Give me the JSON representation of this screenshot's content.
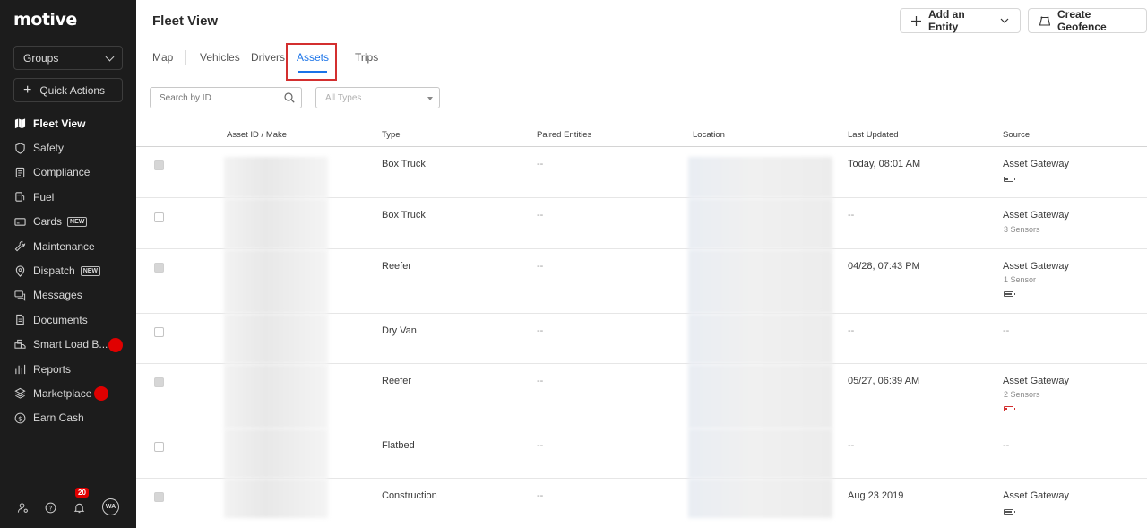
{
  "brand": {
    "logo": "motive"
  },
  "sidebar": {
    "groups_label": "Groups",
    "quick_actions_label": "Quick Actions",
    "items": [
      {
        "label": "Fleet View",
        "icon": "map-icon",
        "active": true
      },
      {
        "label": "Safety",
        "icon": "shield-icon"
      },
      {
        "label": "Compliance",
        "icon": "document-icon"
      },
      {
        "label": "Fuel",
        "icon": "fuel-icon"
      },
      {
        "label": "Cards",
        "icon": "card-icon",
        "tag": "NEW"
      },
      {
        "label": "Maintenance",
        "icon": "wrench-icon"
      },
      {
        "label": "Dispatch",
        "icon": "location-pin-icon",
        "tag": "NEW"
      },
      {
        "label": "Messages",
        "icon": "chat-icon"
      },
      {
        "label": "Documents",
        "icon": "file-icon"
      },
      {
        "label": "Smart Load B...",
        "icon": "truck-load-icon",
        "dot": true
      },
      {
        "label": "Reports",
        "icon": "bar-chart-icon"
      },
      {
        "label": "Marketplace",
        "icon": "layers-icon",
        "dot": true
      },
      {
        "label": "Earn Cash",
        "icon": "dollar-icon"
      }
    ],
    "bottom": {
      "notifications_count": "20",
      "avatar_initials": "WA"
    }
  },
  "header": {
    "title": "Fleet View",
    "add_entity_label": "Add an Entity",
    "create_geofence_label": "Create Geofence"
  },
  "tabs": [
    "Map",
    "Vehicles",
    "Drivers",
    "Assets",
    "Trips"
  ],
  "active_tab": "Assets",
  "filters": {
    "search_placeholder": "Search by ID",
    "type_placeholder": "All Types"
  },
  "table": {
    "columns": [
      "Asset ID / Make",
      "Type",
      "Paired Entities",
      "Location",
      "Last Updated",
      "Source"
    ],
    "rows": [
      {
        "type": "Box Truck",
        "paired": "--",
        "updated": "Today, 08:01 AM",
        "source": "Asset Gateway",
        "source_sub": "",
        "battery": "low-gray",
        "checkbox_disabled": true
      },
      {
        "type": "Box Truck",
        "paired": "--",
        "updated": "--",
        "source": "Asset Gateway",
        "source_sub": "3 Sensors",
        "battery": "",
        "checkbox_disabled": false
      },
      {
        "type": "Reefer",
        "paired": "--",
        "updated": "04/28, 07:43 PM",
        "source": "Asset Gateway",
        "source_sub": "1 Sensor",
        "battery": "full",
        "checkbox_disabled": true
      },
      {
        "type": "Dry Van",
        "paired": "--",
        "updated": "--",
        "source": "--",
        "source_sub": "",
        "battery": "",
        "checkbox_disabled": false
      },
      {
        "type": "Reefer",
        "paired": "--",
        "updated": "05/27, 06:39 AM",
        "source": "Asset Gateway",
        "source_sub": "2 Sensors",
        "battery": "low-red",
        "checkbox_disabled": true
      },
      {
        "type": "Flatbed",
        "paired": "--",
        "updated": "--",
        "source": "--",
        "source_sub": "",
        "battery": "",
        "checkbox_disabled": false
      },
      {
        "type": "Construction",
        "paired": "--",
        "updated": "Aug 23 2019",
        "source": "Asset Gateway",
        "source_sub": "",
        "battery": "full",
        "checkbox_disabled": true
      }
    ]
  }
}
